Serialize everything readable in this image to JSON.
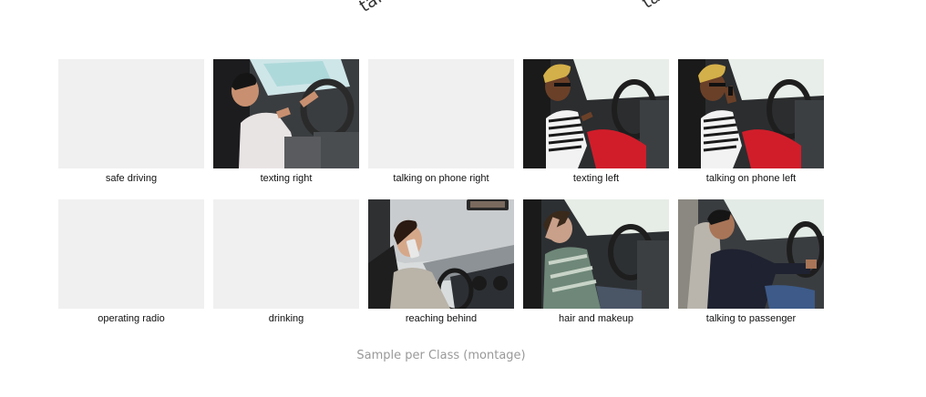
{
  "top_fragments": [
    "talk",
    "ta"
  ],
  "montage": {
    "rows": [
      [
        {
          "label": "safe driving",
          "image": "blank"
        },
        {
          "label": "texting right",
          "image": "photo-man-texting"
        },
        {
          "label": "talking on phone right",
          "image": "blank"
        },
        {
          "label": "texting left",
          "image": "photo-woman-texting"
        },
        {
          "label": "talking on phone left",
          "image": "photo-woman-phone"
        }
      ],
      [
        {
          "label": "operating radio",
          "image": "blank"
        },
        {
          "label": "drinking",
          "image": "blank"
        },
        {
          "label": "reaching behind",
          "image": "photo-woman-phone-window"
        },
        {
          "label": "hair and makeup",
          "image": "photo-man-hair"
        },
        {
          "label": "talking to passenger",
          "image": "photo-man-passenger"
        }
      ]
    ]
  },
  "figure_caption": "Sample per Class (montage)"
}
